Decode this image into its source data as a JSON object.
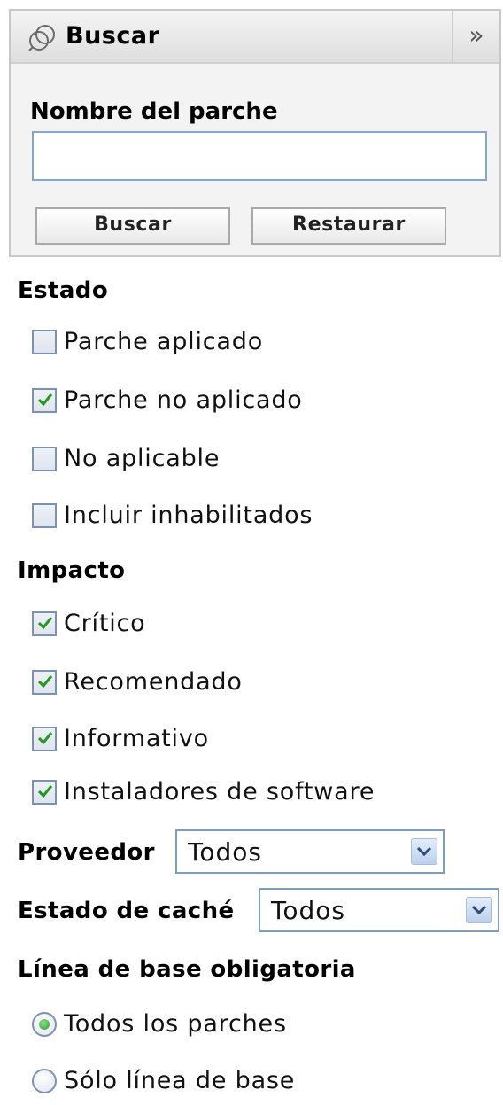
{
  "panel": {
    "title": "Buscar",
    "collapse_icon": "double-chevron-right-icon",
    "field_label": "Nombre del parche",
    "field_value": "",
    "search_button": "Buscar",
    "reset_button": "Restaurar"
  },
  "estado": {
    "title": "Estado",
    "options": [
      {
        "label": "Parche aplicado",
        "checked": false
      },
      {
        "label": "Parche no aplicado",
        "checked": true
      },
      {
        "label": "No aplicable",
        "checked": false
      },
      {
        "label": "Incluir inhabilitados",
        "checked": false
      }
    ]
  },
  "impacto": {
    "title": "Impacto",
    "options": [
      {
        "label": "Crítico",
        "checked": true
      },
      {
        "label": "Recomendado",
        "checked": true
      },
      {
        "label": "Informativo",
        "checked": true
      },
      {
        "label": "Instaladores de software",
        "checked": true
      }
    ]
  },
  "proveedor": {
    "label": "Proveedor",
    "value": "Todos"
  },
  "estado_cache": {
    "label": "Estado de caché",
    "value": "Todos"
  },
  "baseline": {
    "title": "Línea de base obligatoria",
    "options": [
      {
        "label": "Todos los parches",
        "selected": true
      },
      {
        "label": "Sólo línea de base",
        "selected": false
      }
    ]
  },
  "colors": {
    "check_green": "#1f9a1f",
    "input_border": "#86a7c8",
    "control_border": "#7b93b0"
  }
}
